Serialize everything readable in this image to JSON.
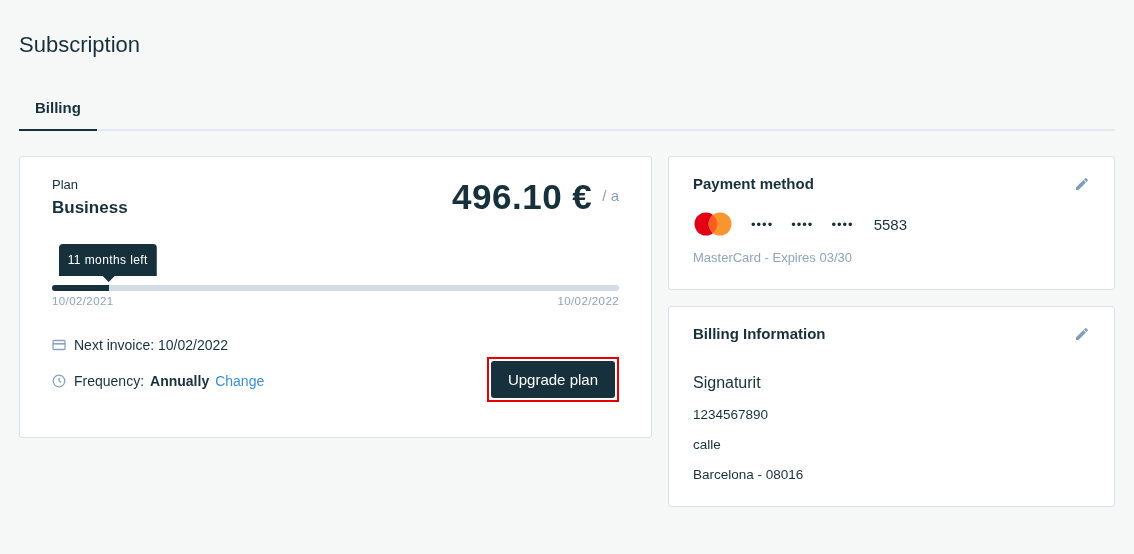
{
  "page_title": "Subscription",
  "tabs": [
    {
      "label": "Billing",
      "selected": true
    }
  ],
  "plan": {
    "label": "Plan",
    "name": "Business",
    "price": "496.10 €",
    "period": "/ a",
    "tooltip": "11 months left",
    "level": 0.1,
    "start_date": "10/02/2021",
    "end_date": "10/02/2022",
    "next_invoice": "Next invoice: 10/02/2022",
    "frequency_label": "Frequency:",
    "frequency_value": "Annually",
    "change_link": "Change",
    "upgrade_button": {
      "label": "Upgrade plan",
      "highlighted": true
    }
  },
  "payment_method": {
    "title": "Payment method",
    "masked_groups": [
      "••••",
      "••••",
      "••••"
    ],
    "last_digits": "5583",
    "details": "MasterCard - Expires 03/30"
  },
  "billing_information": {
    "title": "Billing Information",
    "company": "Signaturit",
    "lines": [
      "1234567890",
      "calle",
      "Barcelona - 08016"
    ]
  }
}
